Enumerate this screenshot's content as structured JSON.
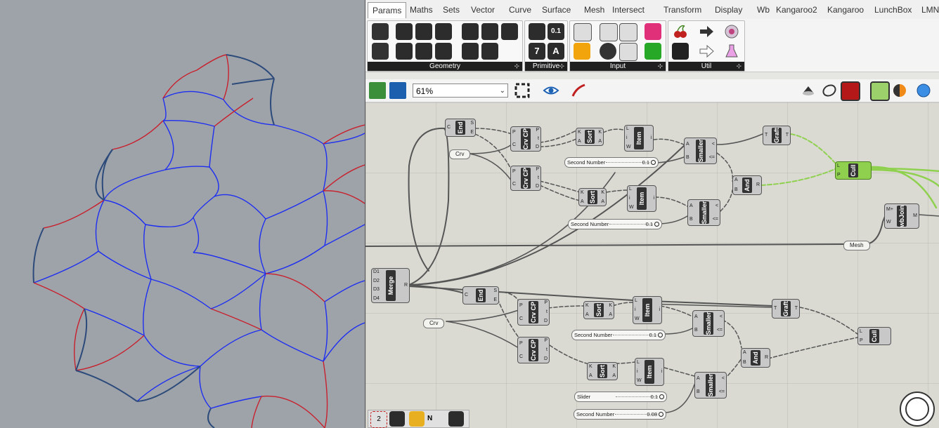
{
  "tabs": [
    "Params",
    "Maths",
    "Sets",
    "Vector",
    "Curve",
    "Surface",
    "Mesh",
    "Intersect",
    "Transform",
    "Display",
    "Wb",
    "Kangaroo2",
    "Kangaroo",
    "LunchBox",
    "LMNts"
  ],
  "active_tab": "Params",
  "ribbon_groups": [
    {
      "label": "Geometry",
      "expand": "⊹"
    },
    {
      "label": "Primitive",
      "expand": "⊹"
    },
    {
      "label": "Input",
      "expand": "⊹"
    },
    {
      "label": "Util",
      "expand": "⊹"
    }
  ],
  "primitive_icons": {
    "num": "0.1",
    "int": "7",
    "text": "A"
  },
  "zoom": {
    "value": "61%",
    "arrow": "⌄"
  },
  "components": {
    "end_top": "End",
    "crv_cp_1": "Crv CP",
    "crv_cp_2": "Crv CP",
    "sort_1": "Sort",
    "sort_2": "Sort",
    "item_1": "Item",
    "item_2": "Item",
    "smaller_1": "Smaller",
    "smaller_2": "Smaller",
    "graft_1": "Graft",
    "and_1": "And",
    "cull_1": "Cull",
    "wbjoin": "wbJoin",
    "merge": "Merge",
    "end_bottom": "End",
    "crv_cp_3": "Crv CP",
    "crv_cp_4": "Crv CP",
    "sort_3": "Sort",
    "sort_4": "Sort",
    "item_3": "Item",
    "item_4": "Item",
    "smaller_3": "Smaller",
    "smaller_4": "Smaller",
    "graft_2": "Graft",
    "and_2": "And",
    "cull_2": "Cull"
  },
  "params": {
    "crv_1": "Crv",
    "crv_2": "Crv",
    "mesh": "Mesh"
  },
  "sliders": [
    {
      "label": "Second Number",
      "value": "0.1"
    },
    {
      "label": "Second Number",
      "value": "0.1"
    },
    {
      "label": "Second Number",
      "value": "0.1"
    },
    {
      "label": "Slider",
      "value": "0.1"
    },
    {
      "label": "Second Number",
      "value": "0.08"
    }
  ],
  "pins": {
    "merge_in": [
      "D1",
      "D2",
      "D3",
      "D4"
    ],
    "merge_out": "R",
    "end_in": "C",
    "end_out": [
      "S",
      "E"
    ],
    "crv_in": [
      "P",
      "C"
    ],
    "crv_out": [
      "P",
      "t",
      "D"
    ],
    "sort_in": [
      "K",
      "A"
    ],
    "sort_out": [
      "K",
      "A"
    ],
    "item_in": [
      "L",
      "i",
      "W"
    ],
    "item_out": "i",
    "smaller_in": [
      "A",
      "B"
    ],
    "smaller_out": [
      "<",
      "<="
    ],
    "graft_in": "T",
    "graft_out": "T",
    "and_in": [
      "A",
      "B"
    ],
    "and_out": "R",
    "cull_in": [
      "L",
      "P"
    ],
    "wbjoin_in": [
      "M+",
      "W"
    ],
    "wbjoin_out": "M"
  },
  "bottom_bar": {
    "counter": "2",
    "group_label": "N"
  },
  "colors": {
    "curve_blue": "#1e2ff0",
    "curve_red": "#c8202c",
    "curve_darkblue": "#2c4a7a",
    "curve_darkred": "#b0283a",
    "wire_green": "#8fd14f"
  }
}
